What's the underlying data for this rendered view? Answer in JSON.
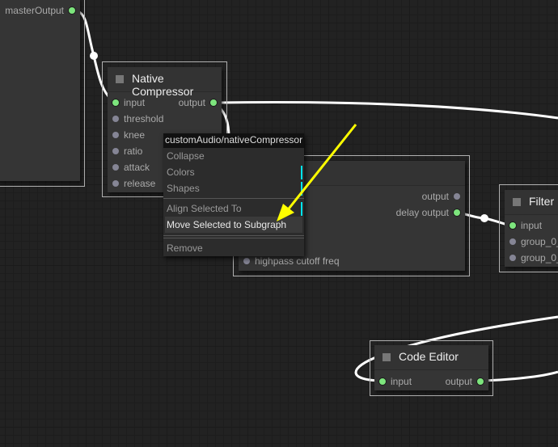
{
  "nodes": {
    "master": {
      "output_label": "masterOutput"
    },
    "compressor": {
      "title": "Native Compressor",
      "inputs": [
        "input",
        "threshold",
        "knee",
        "ratio",
        "attack",
        "release"
      ],
      "output": "output"
    },
    "delay": {
      "outputs": [
        "output",
        "delay output"
      ],
      "input_partial": "highpass cutoff freq"
    },
    "filter": {
      "title": "Filter",
      "inputs": [
        "input",
        "group_0_",
        "group_0_"
      ]
    },
    "code_editor": {
      "title": "Code Editor",
      "input": "input",
      "output": "output"
    }
  },
  "context_menu": {
    "title": "customAudio/nativeCompressor",
    "items": [
      "Collapse",
      "Colors",
      "Shapes",
      "Align Selected To",
      "Move Selected to Subgraph",
      "Remove"
    ],
    "highlighted": "Move Selected to Subgraph"
  },
  "annotation": {
    "color": "#ffff00",
    "points_to": "Move Selected to Subgraph"
  },
  "colors": {
    "connected_slot": "#7de57d",
    "empty_slot": "#858595",
    "link": "#ffffff",
    "submenu_marker": "#00e5ee"
  }
}
